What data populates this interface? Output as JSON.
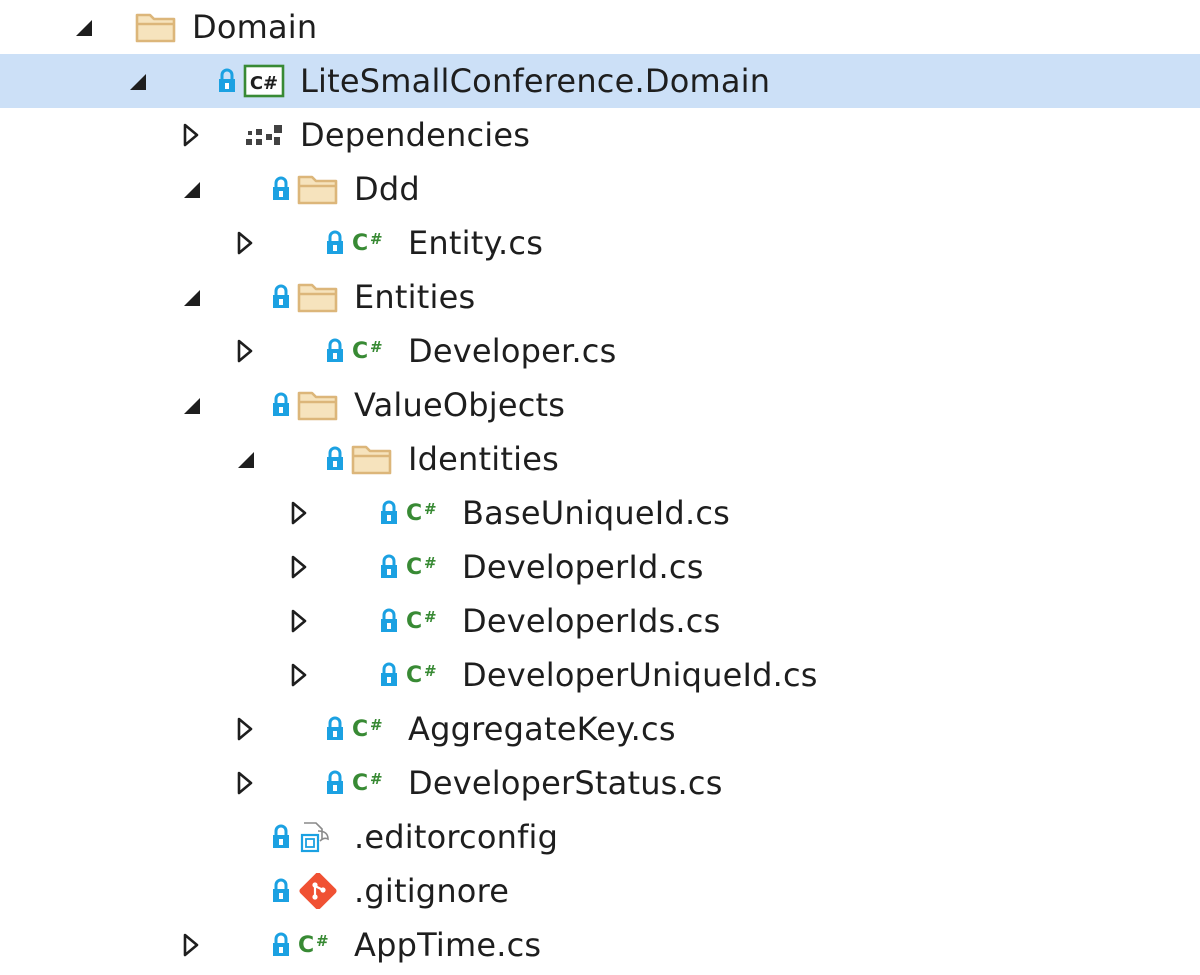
{
  "tree": {
    "nodes": [
      {
        "label": "Domain",
        "depth": 0,
        "expander": "expanded",
        "locked": false,
        "icon": "folder-icon"
      },
      {
        "label": "LiteSmallConference.Domain",
        "depth": 1,
        "expander": "expanded",
        "locked": true,
        "icon": "csharp-project-icon",
        "selected": true
      },
      {
        "label": "Dependencies",
        "depth": 2,
        "expander": "collapsed",
        "locked": false,
        "icon": "dependencies-icon"
      },
      {
        "label": "Ddd",
        "depth": 2,
        "expander": "expanded",
        "locked": true,
        "icon": "folder-icon"
      },
      {
        "label": "Entity.cs",
        "depth": 3,
        "expander": "collapsed",
        "locked": true,
        "icon": "csharp-file-icon"
      },
      {
        "label": "Entities",
        "depth": 2,
        "expander": "expanded",
        "locked": true,
        "icon": "folder-icon"
      },
      {
        "label": "Developer.cs",
        "depth": 3,
        "expander": "collapsed",
        "locked": true,
        "icon": "csharp-file-icon"
      },
      {
        "label": "ValueObjects",
        "depth": 2,
        "expander": "expanded",
        "locked": true,
        "icon": "folder-icon"
      },
      {
        "label": "Identities",
        "depth": 3,
        "expander": "expanded",
        "locked": true,
        "icon": "folder-icon"
      },
      {
        "label": "BaseUniqueId.cs",
        "depth": 4,
        "expander": "collapsed",
        "locked": true,
        "icon": "csharp-file-icon"
      },
      {
        "label": "DeveloperId.cs",
        "depth": 4,
        "expander": "collapsed",
        "locked": true,
        "icon": "csharp-file-icon"
      },
      {
        "label": "DeveloperIds.cs",
        "depth": 4,
        "expander": "collapsed",
        "locked": true,
        "icon": "csharp-file-icon"
      },
      {
        "label": "DeveloperUniqueId.cs",
        "depth": 4,
        "expander": "collapsed",
        "locked": true,
        "icon": "csharp-file-icon"
      },
      {
        "label": "AggregateKey.cs",
        "depth": 3,
        "expander": "collapsed",
        "locked": true,
        "icon": "csharp-file-icon"
      },
      {
        "label": "DeveloperStatus.cs",
        "depth": 3,
        "expander": "collapsed",
        "locked": true,
        "icon": "csharp-file-icon"
      },
      {
        "label": ".editorconfig",
        "depth": 2,
        "expander": "none",
        "locked": true,
        "icon": "editorconfig-file-icon"
      },
      {
        "label": ".gitignore",
        "depth": 2,
        "expander": "none",
        "locked": true,
        "icon": "gitignore-file-icon"
      },
      {
        "label": "AppTime.cs",
        "depth": 2,
        "expander": "collapsed",
        "locked": true,
        "icon": "csharp-file-icon"
      }
    ]
  },
  "colors": {
    "selection": "#cce0f7",
    "folder": "#dcb67a",
    "csharp": "#388a34",
    "lock": "#1ba1e2",
    "git": "#f05133",
    "text": "#1e1e1e"
  }
}
